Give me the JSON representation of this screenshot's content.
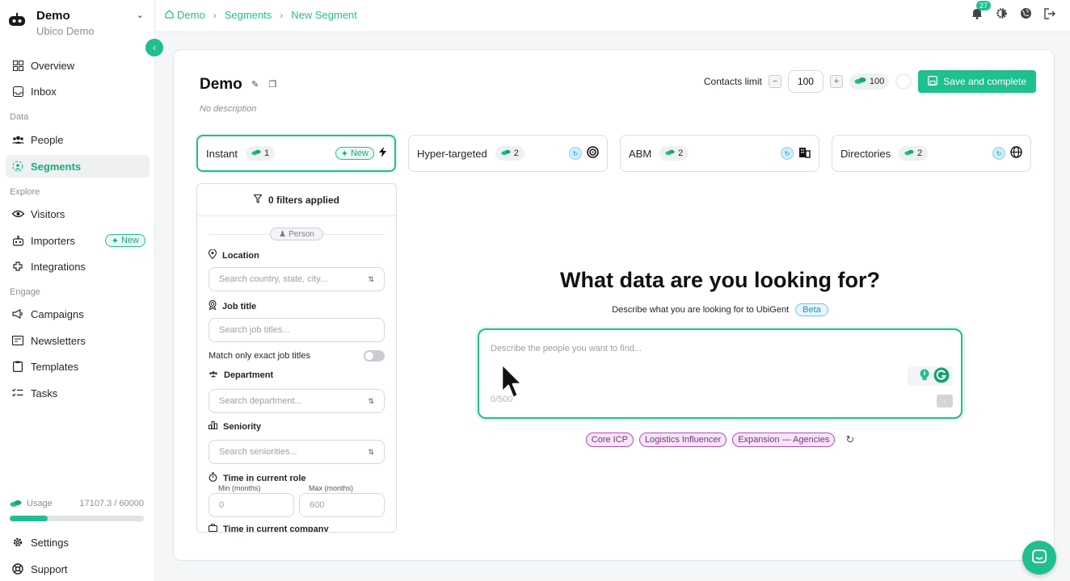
{
  "workspace": {
    "name": "Demo",
    "subtitle": "Ubico Demo"
  },
  "sidebar": {
    "items": [
      {
        "label": "Overview",
        "icon": "dashboard-icon"
      },
      {
        "label": "Inbox",
        "icon": "inbox-icon"
      },
      {
        "label": "People",
        "icon": "people-icon"
      },
      {
        "label": "Segments",
        "icon": "segments-icon",
        "active": true
      },
      {
        "label": "Visitors",
        "icon": "eye-icon"
      },
      {
        "label": "Importers",
        "icon": "importer-icon",
        "badge": "New"
      },
      {
        "label": "Integrations",
        "icon": "integrations-icon"
      },
      {
        "label": "Campaigns",
        "icon": "megaphone-icon"
      },
      {
        "label": "Newsletters",
        "icon": "newsletter-icon"
      },
      {
        "label": "Templates",
        "icon": "clipboard-icon"
      },
      {
        "label": "Tasks",
        "icon": "tasks-icon"
      },
      {
        "label": "Settings",
        "icon": "gear-icon"
      },
      {
        "label": "Support",
        "icon": "lifebuoy-icon"
      }
    ],
    "sections": {
      "data": "Data",
      "explore": "Explore",
      "engage": "Engage"
    },
    "usage": {
      "label": "Usage",
      "value": "17107.3 / 60000",
      "fraction": 0.285
    }
  },
  "breadcrumb": {
    "home": "Demo",
    "level2": "Segments",
    "level3": "New Segment"
  },
  "notifications": {
    "count": "27"
  },
  "segment": {
    "title": "Demo",
    "description": "No description",
    "contacts_limit_label": "Contacts limit",
    "contacts_limit_value": "100",
    "credits": "100",
    "save_label": "Save and complete"
  },
  "tabs": [
    {
      "label": "Instant",
      "count": "1",
      "badge": "New",
      "icon": "bolt-icon"
    },
    {
      "label": "Hyper-targeted",
      "count": "2",
      "icon": "target-icon"
    },
    {
      "label": "ABM",
      "count": "2",
      "icon": "building-icon"
    },
    {
      "label": "Directories",
      "count": "2",
      "icon": "globe-icon"
    }
  ],
  "filters": {
    "header": "0 filters applied",
    "group": "Person",
    "location": {
      "label": "Location",
      "placeholder": "Search country, state, city..."
    },
    "job_title": {
      "label": "Job title",
      "placeholder": "Search job titles...",
      "exact_label": "Match only exact job titles"
    },
    "department": {
      "label": "Department",
      "placeholder": "Search department..."
    },
    "seniority": {
      "label": "Seniority",
      "placeholder": "Search seniorities..."
    },
    "time_in_role": {
      "label": "Time in current role",
      "min_label": "Min (months)",
      "max_label": "Max (months)",
      "min_value": "0",
      "max_value": "600"
    },
    "time_in_company": {
      "label": "Time in current company"
    }
  },
  "ai": {
    "heading": "What data are you looking for?",
    "subtitle": "Describe what you are looking for to UbiGent",
    "beta": "Beta",
    "placeholder": "Describe the people you want to find...",
    "counter": "0/500",
    "suggestions": [
      "Core ICP",
      "Logistics Influencer",
      "Expansion — Agencies"
    ]
  },
  "colors": {
    "accent": "#1fbf8f",
    "suggestion": "#b04fb8",
    "beta": "#2a8fb3"
  }
}
